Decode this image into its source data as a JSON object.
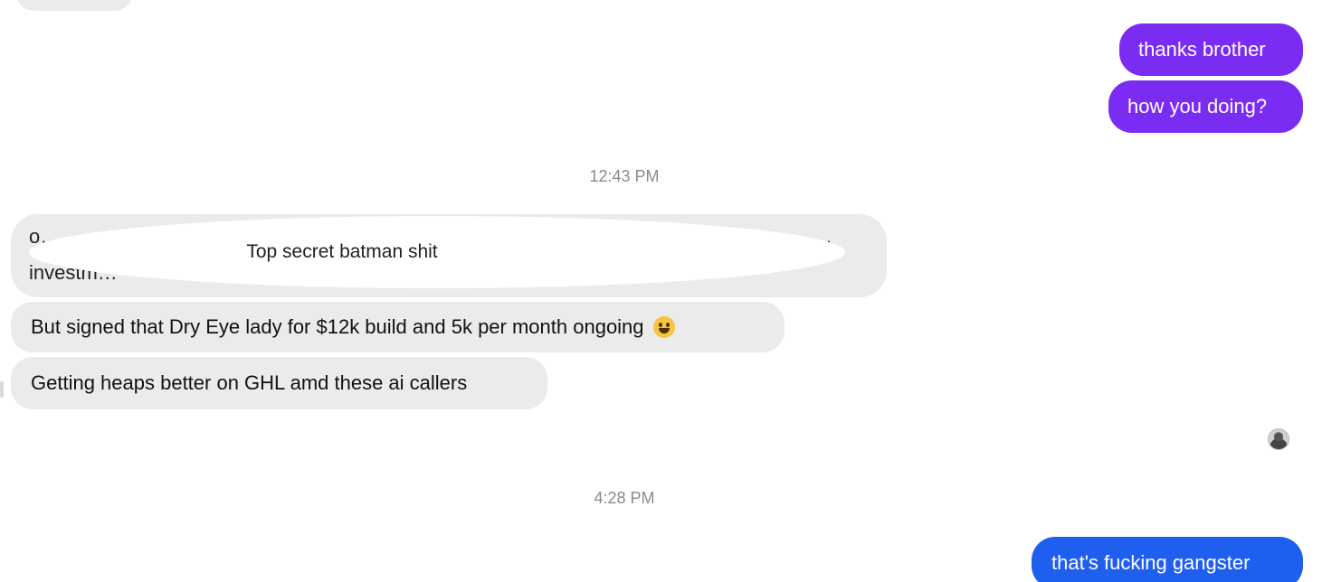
{
  "messages": {
    "out_1": "thanks brother",
    "out_2": "how you doing?",
    "time_1": "12:43 PM",
    "redacted_label": "Top secret batman shit",
    "redacted_fragment_top": "o…",
    "redacted_fragment_bottom": "investm…",
    "redacted_fragment_right": "…",
    "in_2": "But signed that Dry Eye lady for $12k build and 5k per month ongoing",
    "in_3": "Getting heaps better on GHL amd these ai callers",
    "time_2": "4:28 PM",
    "out_3": "that's fucking gangster"
  },
  "icons": {
    "emoji": "grinning-face-emoji",
    "avatar": "read-receipt-avatar"
  },
  "colors": {
    "incoming_bubble": "#ebebeb",
    "outgoing_purple": "#7b2cf3",
    "outgoing_blue": "#1f5ff0",
    "timestamp_text": "#8a8a8a"
  }
}
